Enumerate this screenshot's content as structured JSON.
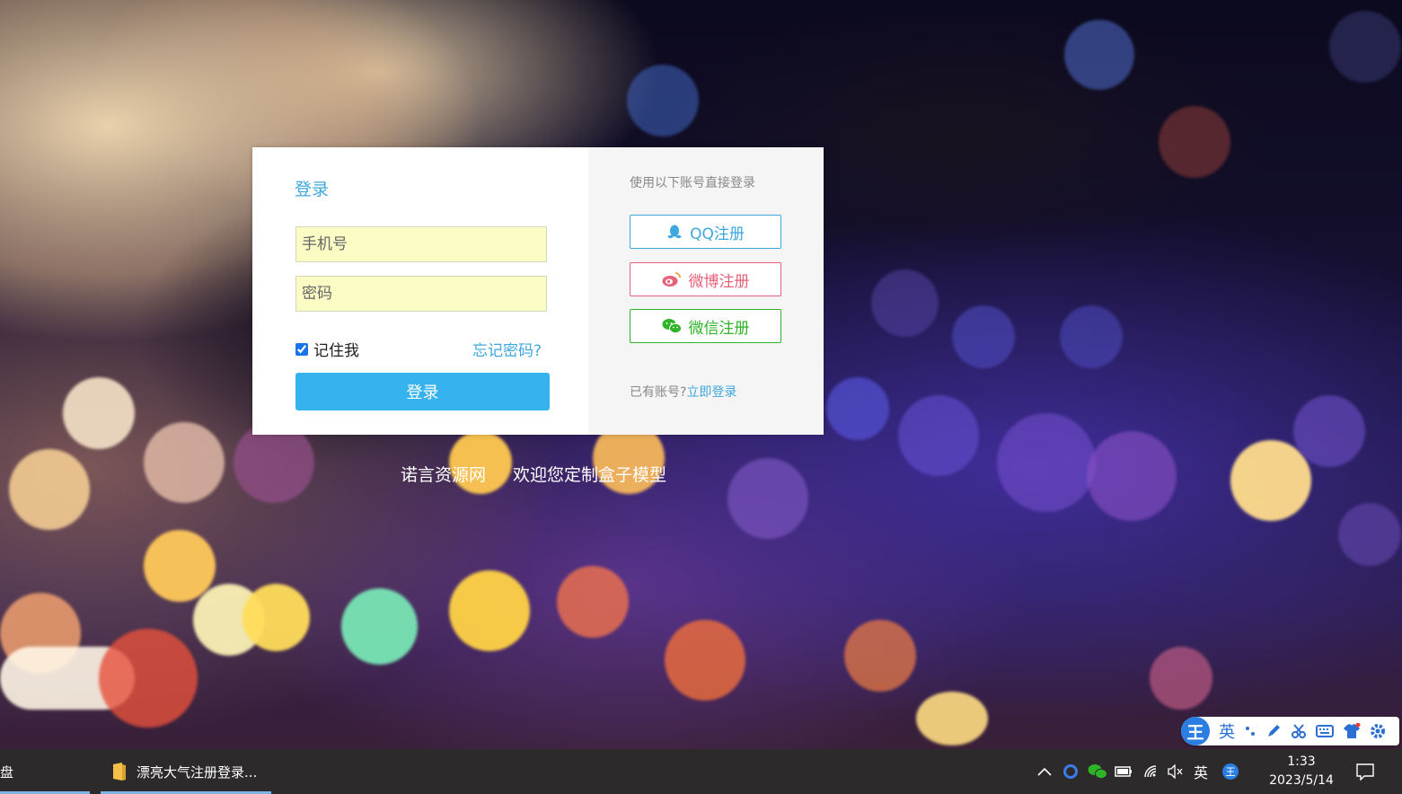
{
  "login": {
    "title": "登录",
    "phone_placeholder": "手机号",
    "password_placeholder": "密码",
    "remember_label": "记住我",
    "remember_checked": true,
    "forgot_label": "忘记密码?",
    "submit_label": "登录"
  },
  "social": {
    "hint": "使用以下账号直接登录",
    "qq_label": "QQ注册",
    "weibo_label": "微博注册",
    "wechat_label": "微信注册",
    "have_account": "已有账号?",
    "login_now": "立即登录"
  },
  "footer": {
    "site": "诺言资源网",
    "slogan": "欢迎您定制盒子模型"
  },
  "ime": {
    "logo": "王",
    "mode": "英"
  },
  "taskbar": {
    "left_label": "盘",
    "window_title": "漂亮大气注册登录...",
    "tray_lang": "英",
    "time": "1:33",
    "date": "2023/5/14"
  },
  "colors": {
    "accent": "#3ea7dd",
    "button": "#36b3ef",
    "weibo": "#e8617a",
    "wechat": "#2fb427",
    "taskbar": "#2c2a2a"
  }
}
